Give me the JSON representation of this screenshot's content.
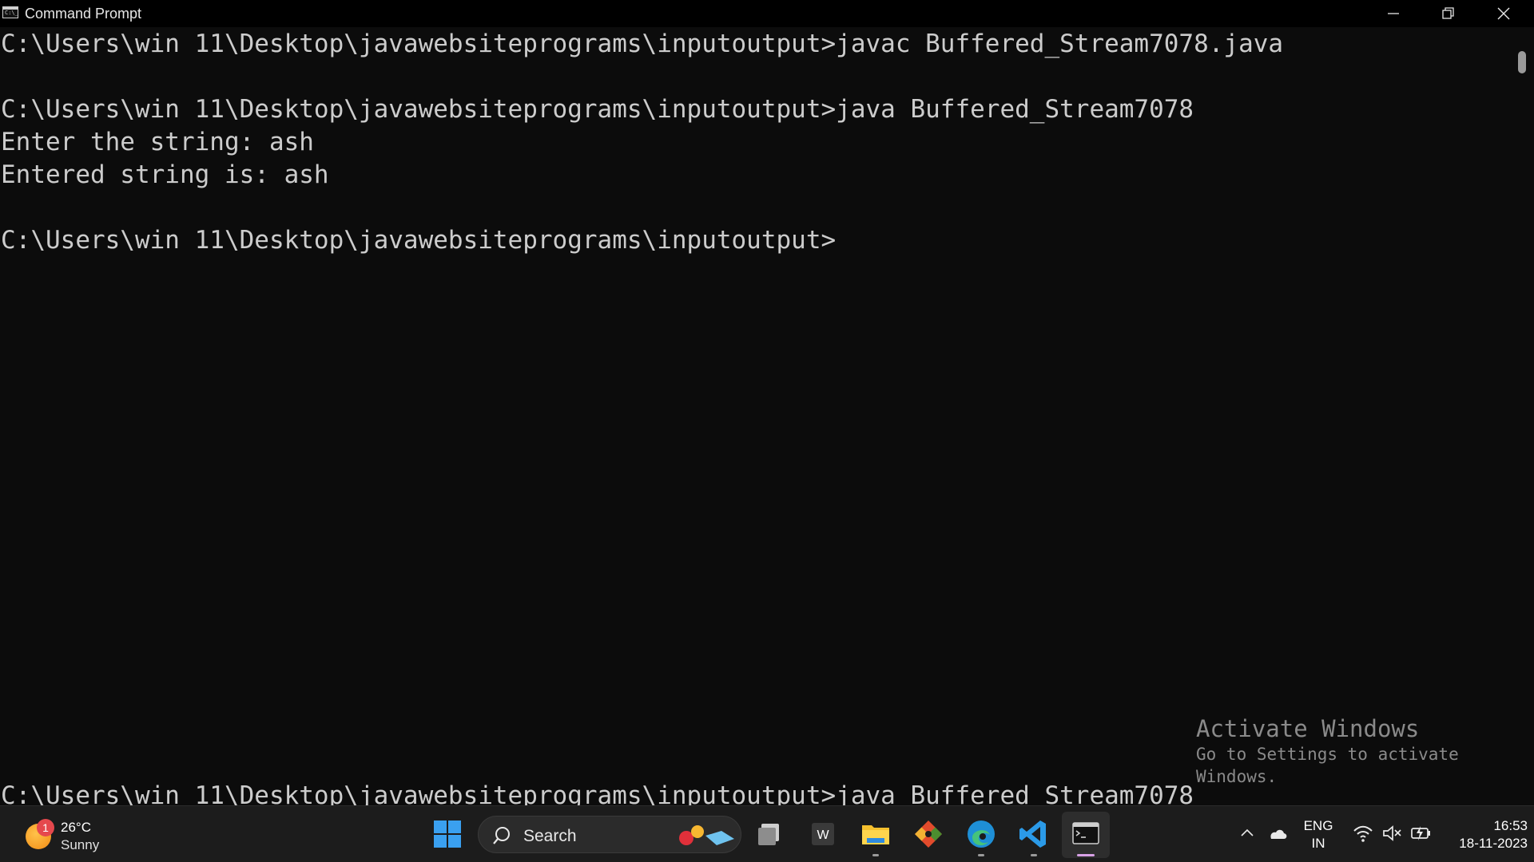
{
  "window": {
    "title": "Command Prompt",
    "icon_text": "C:\\_"
  },
  "console": {
    "lines": [
      "C:\\Users\\win 11\\Desktop\\javawebsiteprograms\\inputoutput>javac Buffered_Stream7078.java",
      "",
      "C:\\Users\\win 11\\Desktop\\javawebsiteprograms\\inputoutput>java Buffered_Stream7078",
      "Enter the string: ash",
      "Entered string is: ash",
      "",
      "C:\\Users\\win 11\\Desktop\\javawebsiteprograms\\inputoutput>"
    ],
    "bottom_line": "C:\\Users\\win 11\\Desktop\\javawebsiteprograms\\inputoutput>java Buffered_Stream7078"
  },
  "watermark": {
    "title": "Activate Windows",
    "subtitle": "Go to Settings to activate Windows."
  },
  "taskbar": {
    "weather": {
      "badge": "1",
      "temperature": "26°C",
      "condition": "Sunny"
    },
    "search_label": "Search",
    "apps": [
      "start-icon",
      "task-view-icon",
      "word-icon",
      "file-explorer-icon",
      "git-icon",
      "edge-icon",
      "vscode-icon",
      "terminal-icon"
    ],
    "language": {
      "line1": "ENG",
      "line2": "IN"
    },
    "clock": {
      "time": "16:53",
      "date": "18-11-2023"
    }
  },
  "colors": {
    "console_bg": "#0c0c0c",
    "console_text": "#cccccc",
    "taskbar_bg": "#1c1c1c",
    "active_indicator": "#d8a1e6"
  }
}
